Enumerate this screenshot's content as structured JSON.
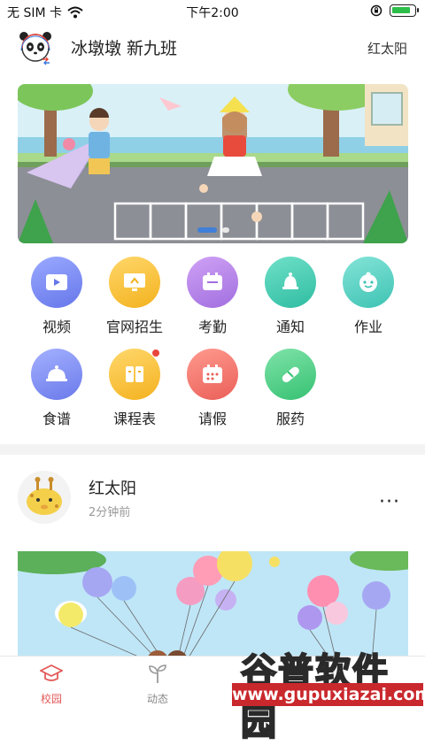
{
  "status_bar": {
    "carrier": "无 SIM 卡",
    "time": "下午2:00"
  },
  "header": {
    "school_name": "冰墩墩   新九班",
    "user_name": "红太阳"
  },
  "banner": {
    "slide_count": 3,
    "active_slide": 1
  },
  "grid": {
    "items": [
      {
        "label": "视频",
        "icon": "video-icon",
        "color": "#7b8ff0"
      },
      {
        "label": "官网招生",
        "icon": "monitor-icon",
        "color": "#f6c33c"
      },
      {
        "label": "考勤",
        "icon": "attendance-icon",
        "color": "#b98ae8"
      },
      {
        "label": "通知",
        "icon": "bell-icon",
        "color": "#49d0b6"
      },
      {
        "label": "作业",
        "icon": "baby-face-icon",
        "color": "#5fd2c5"
      },
      {
        "label": "食谱",
        "icon": "cloche-icon",
        "color": "#8293f1"
      },
      {
        "label": "课程表",
        "icon": "book-icon",
        "color": "#f7c23a"
      },
      {
        "label": "请假",
        "icon": "calendar-icon",
        "color": "#f07a74"
      },
      {
        "label": "服药",
        "icon": "pill-icon",
        "color": "#4fcf8a"
      }
    ]
  },
  "post": {
    "author": "红太阳",
    "time": "2分钟前",
    "more": "···"
  },
  "tabs": [
    {
      "label": "校园",
      "icon": "graduation-cap-icon",
      "active": true
    },
    {
      "label": "动态",
      "icon": "sprout-icon",
      "active": false
    }
  ],
  "watermark": {
    "title": "谷普软件园",
    "url": "www.gupuxiazai.com"
  },
  "colors": {
    "accent_red": "#e35a5a",
    "carousel_active": "#3f7fd9"
  }
}
